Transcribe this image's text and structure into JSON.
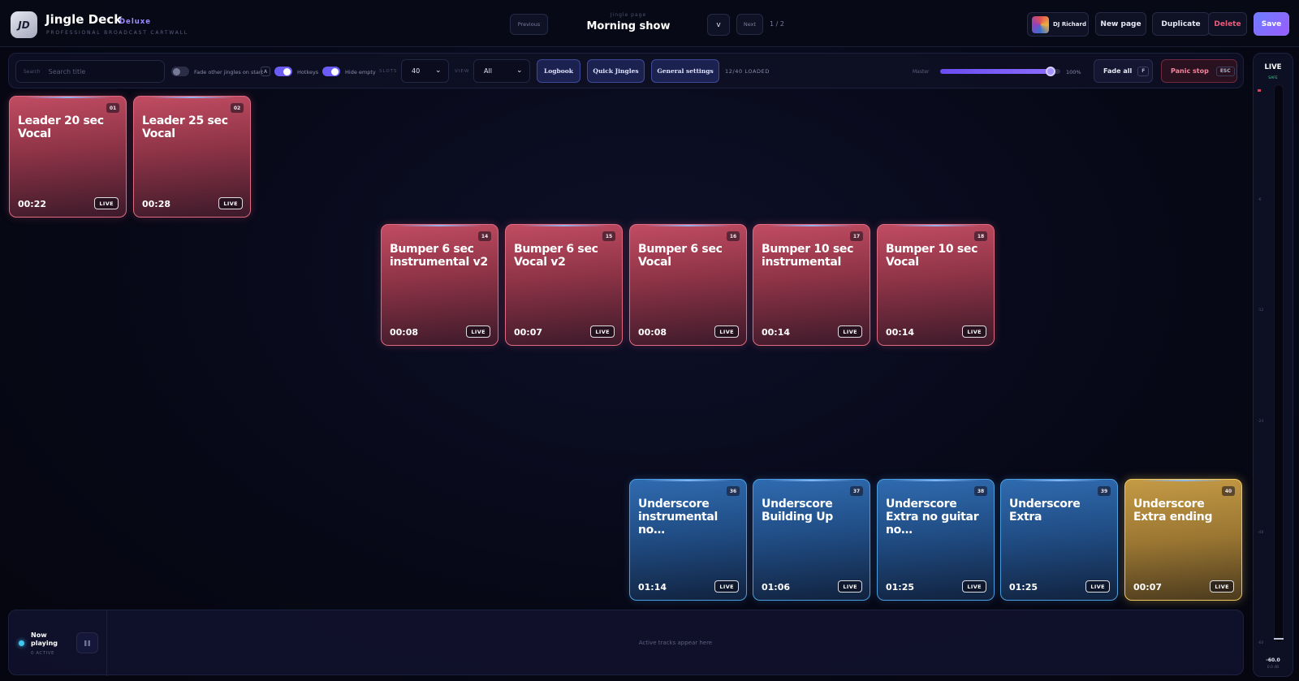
{
  "app": {
    "logo_text": "JD",
    "title": "Jingle Deck",
    "edition": "Deluxe",
    "tagline": "PROFESSIONAL BROADCAST CARTWALL"
  },
  "header": {
    "previous_label": "Previous",
    "page_label": "Jingle page",
    "page_name": "Morning show",
    "page_menu_label": "v",
    "next_label": "Next",
    "page_count": "1 / 2",
    "user_name": "DJ Richard",
    "new_page_label": "New page",
    "duplicate_label": "Duplicate",
    "delete_label": "Delete",
    "save_label": "Save"
  },
  "toolbar": {
    "search_label": "Search",
    "search_placeholder": "Search title",
    "fade_other_label": "Fade other jingles on start",
    "fade_other_key": "A",
    "fade_other_on": false,
    "hotkeys_label": "Hotkeys",
    "hotkeys_on": true,
    "hide_empty_label": "Hide empty",
    "hide_empty_on": true,
    "slots_label": "SLOTS",
    "slots_value": "40",
    "view_label": "VIEW",
    "view_value": "All",
    "logbook_label": "Logbook",
    "quick_jingles_label": "Quick Jingles",
    "general_settings_label": "General settings",
    "loaded_text": "12/40 LOADED",
    "master_label": "Master",
    "master_value": 100,
    "master_text": "100%",
    "fade_all_label": "Fade all",
    "fade_all_key": "F",
    "panic_label": "Panic stop",
    "panic_key": "ESC"
  },
  "pads": [
    {
      "num": "01",
      "title": "Leader 20 sec Vocal",
      "time": "00:22",
      "badge": "LIVE",
      "color": "red"
    },
    {
      "num": "02",
      "title": "Leader 25 sec Vocal",
      "time": "00:28",
      "badge": "LIVE",
      "color": "red"
    },
    {
      "num": "14",
      "title": "Bumper 6 sec instrumental v2",
      "time": "00:08",
      "badge": "LIVE",
      "color": "red"
    },
    {
      "num": "15",
      "title": "Bumper 6 sec Vocal v2",
      "time": "00:07",
      "badge": "LIVE",
      "color": "red"
    },
    {
      "num": "16",
      "title": "Bumper 6 sec Vocal",
      "time": "00:08",
      "badge": "LIVE",
      "color": "red"
    },
    {
      "num": "17",
      "title": "Bumper 10 sec instrumental",
      "time": "00:14",
      "badge": "LIVE",
      "color": "red"
    },
    {
      "num": "18",
      "title": "Bumper 10 sec Vocal",
      "time": "00:14",
      "badge": "LIVE",
      "color": "red"
    },
    {
      "num": "36",
      "title": "Underscore instrumental no…",
      "time": "01:14",
      "badge": "LIVE",
      "color": "blue"
    },
    {
      "num": "37",
      "title": "Underscore Building Up",
      "time": "01:06",
      "badge": "LIVE",
      "color": "blue"
    },
    {
      "num": "38",
      "title": "Underscore Extra no guitar no…",
      "time": "01:25",
      "badge": "LIVE",
      "color": "blue"
    },
    {
      "num": "39",
      "title": "Underscore Extra",
      "time": "01:25",
      "badge": "LIVE",
      "color": "blue"
    },
    {
      "num": "40",
      "title": "Underscore Extra ending",
      "time": "00:07",
      "badge": "LIVE",
      "color": "gold"
    }
  ],
  "now_playing": {
    "title": "Now playing",
    "active_text": "0 ACTIVE",
    "empty_text": "Active tracks appear here"
  },
  "meter": {
    "live_label": "LIVE",
    "safe_label": "SAFE",
    "ticks": [
      "-6",
      "-12",
      "-24",
      "-48",
      "-60"
    ],
    "db_value": "-60.0",
    "sub_value": "0.0 dB"
  },
  "colors": {
    "accent": "#6b5cf6",
    "pad_red": "#c14c62",
    "pad_blue": "#2f6bb0",
    "pad_gold": "#c49a45",
    "panic": "#f2849c",
    "safe": "#3dd68c"
  }
}
